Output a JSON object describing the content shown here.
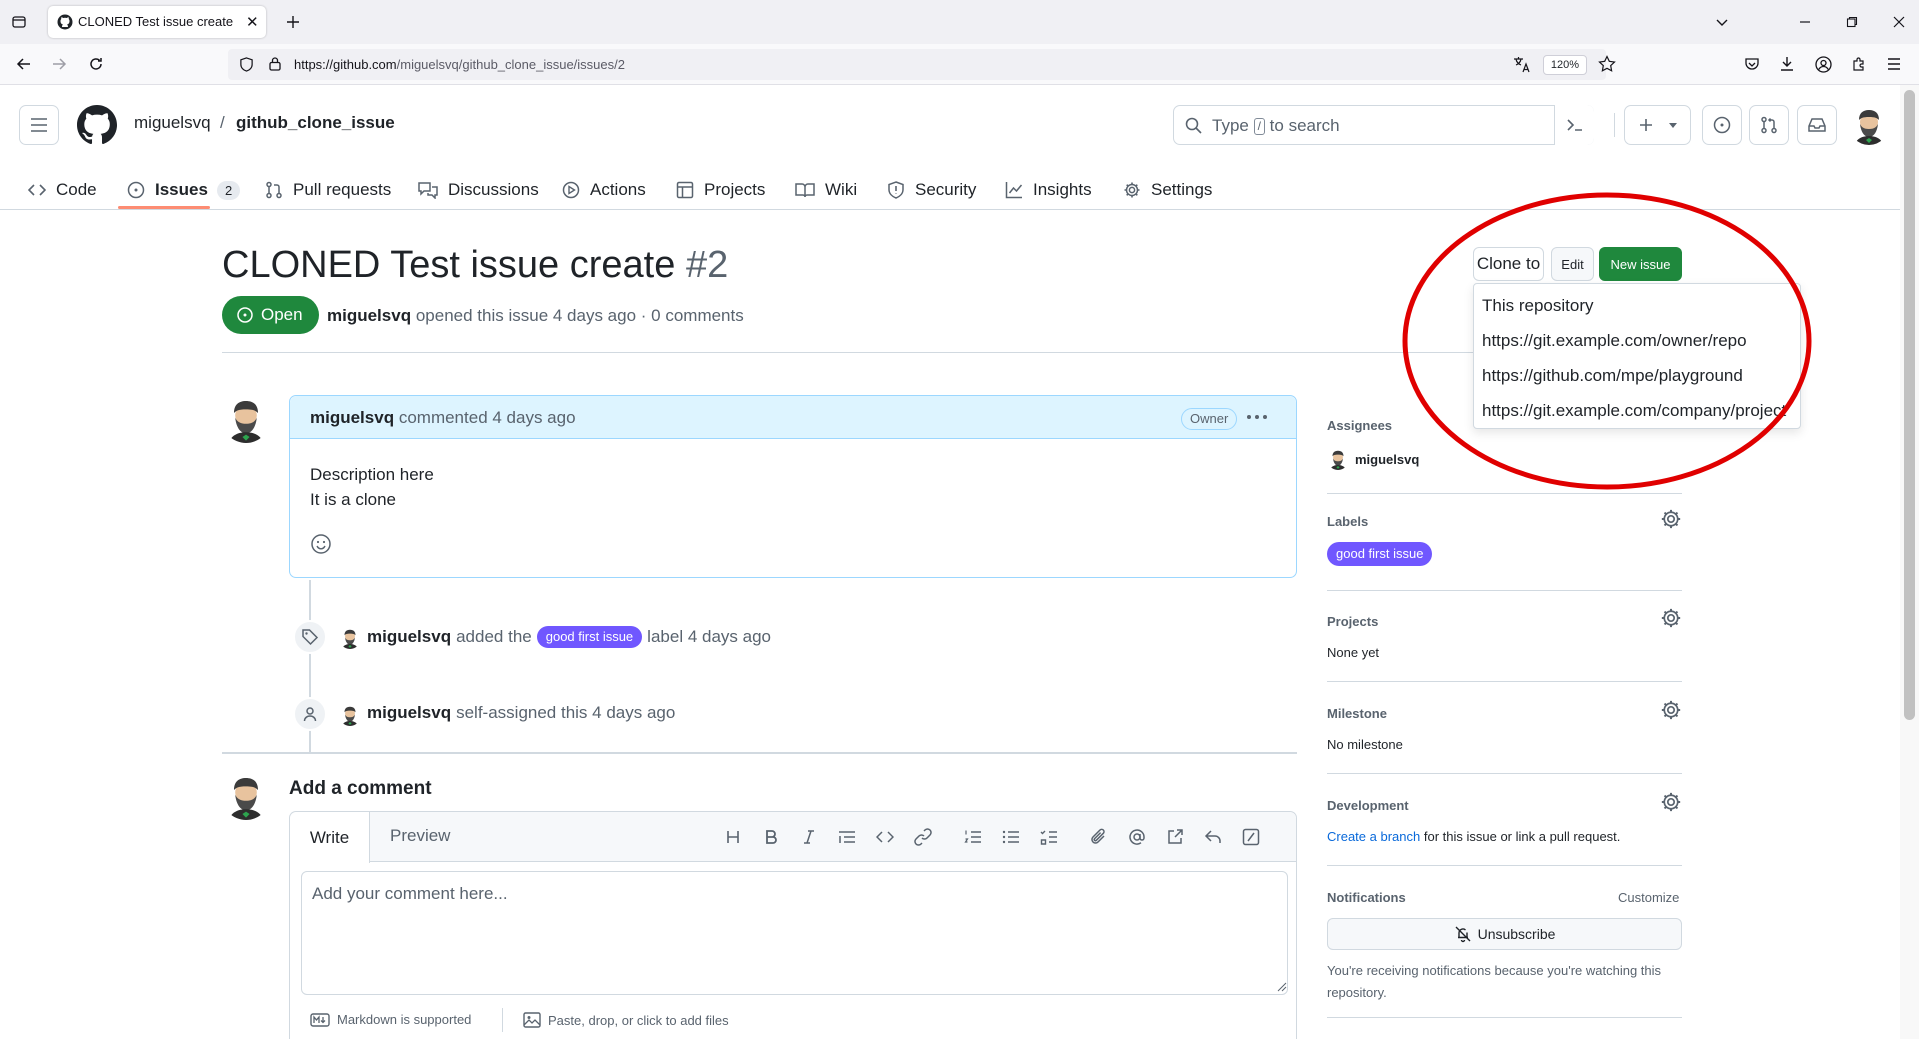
{
  "browser": {
    "tab_title": "CLONED Test issue create · Issue",
    "url_host": "https://github.com",
    "url_path": "/miguelsvq/github_clone_issue/issues/2",
    "zoom": "120%"
  },
  "header": {
    "owner": "miguelsvq",
    "separator": "/",
    "repo": "github_clone_issue",
    "search_prefix": "Type",
    "search_key": "/",
    "search_suffix": "to search"
  },
  "repo_nav": {
    "tabs": [
      {
        "label": "Code"
      },
      {
        "label": "Issues",
        "count": "2"
      },
      {
        "label": "Pull requests"
      },
      {
        "label": "Discussions"
      },
      {
        "label": "Actions"
      },
      {
        "label": "Projects"
      },
      {
        "label": "Wiki"
      },
      {
        "label": "Security"
      },
      {
        "label": "Insights"
      },
      {
        "label": "Settings"
      }
    ]
  },
  "issue": {
    "title": "CLONED Test issue create",
    "number": "#2",
    "state": "Open",
    "author": "miguelsvq",
    "meta": "opened this issue 4 days ago · 0 comments"
  },
  "comment": {
    "author": "miguelsvq",
    "when": "commented 4 days ago",
    "badge": "Owner",
    "body_line1": "Description here",
    "body_line2": "It is a clone"
  },
  "timeline": [
    {
      "actor": "miguelsvq",
      "before": "added the",
      "label": "good first issue",
      "after": "label 4 days ago"
    },
    {
      "actor": "miguelsvq",
      "text": "self-assigned this 4 days ago"
    }
  ],
  "composer": {
    "heading": "Add a comment",
    "write_tab": "Write",
    "preview_tab": "Preview",
    "placeholder": "Add your comment here...",
    "markdown_note": "Markdown is supported",
    "files_note": "Paste, drop, or click to add files"
  },
  "actions": {
    "clone_label": "Clone to",
    "edit_label": "Edit",
    "new_issue_label": "New issue",
    "clone_menu": [
      "This repository",
      "https://git.example.com/owner/repo",
      "https://github.com/mpe/playground",
      "https://git.example.com/company/project"
    ]
  },
  "sidebar": {
    "assignees_title": "Assignees",
    "assignee": "miguelsvq",
    "labels_title": "Labels",
    "label": "good first issue",
    "projects_title": "Projects",
    "projects_value": "None yet",
    "milestone_title": "Milestone",
    "milestone_value": "No milestone",
    "development_title": "Development",
    "development_link": "Create a branch",
    "development_rest": "for this issue or link a pull request.",
    "notifications_title": "Notifications",
    "customize": "Customize",
    "unsubscribe": "Unsubscribe",
    "notif_note_1": "You're receiving notifications because you're watching this",
    "notif_note_2": "repository."
  },
  "colors": {
    "accent_green": "#1f883d",
    "label_purple": "#7057ff",
    "annotation_red": "#e00000",
    "link_blue": "#0969da"
  }
}
